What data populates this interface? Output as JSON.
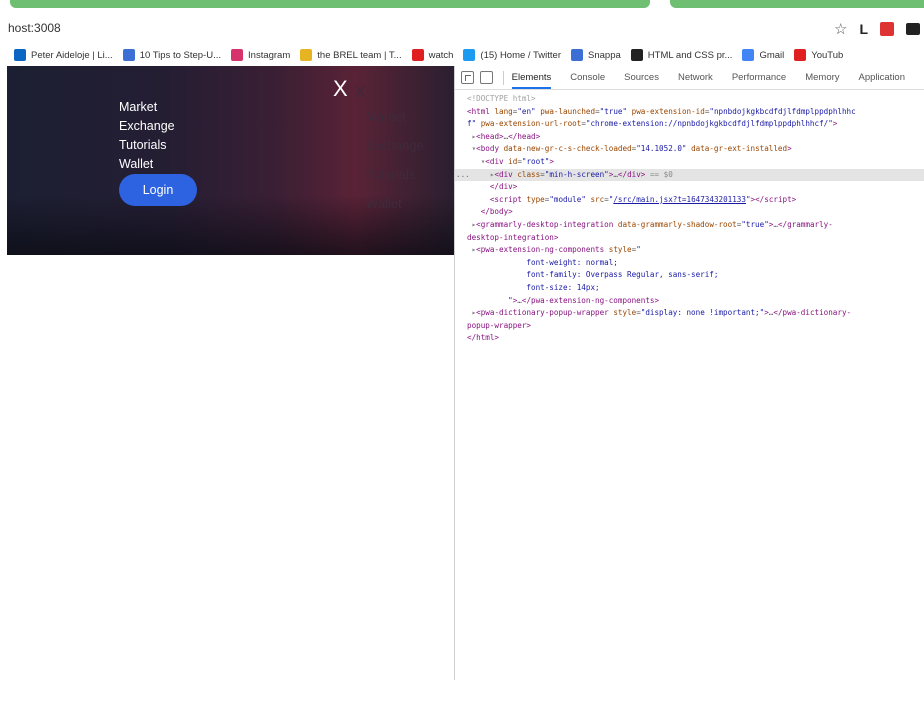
{
  "browser": {
    "url": "host:3008",
    "bookmarks": [
      {
        "label": "Peter Aideloje | Li...",
        "icon": "linkedin-icon",
        "color": "#0a66c2"
      },
      {
        "label": "10 Tips to Step-U...",
        "icon": "page-icon",
        "color": "#3b6fd6"
      },
      {
        "label": "Instagram",
        "icon": "instagram-icon",
        "color": "#d6336c"
      },
      {
        "label": "the BREL team | T...",
        "icon": "folder-icon",
        "color": "#e6b422"
      },
      {
        "label": "watch",
        "icon": "youtube-icon",
        "color": "#e02020"
      },
      {
        "label": "(15) Home / Twitter",
        "icon": "twitter-icon",
        "color": "#1d9bf0"
      },
      {
        "label": "Snappa",
        "icon": "page-icon",
        "color": "#3b6fd6"
      },
      {
        "label": "HTML and CSS pr...",
        "icon": "github-icon",
        "color": "#222222"
      },
      {
        "label": "Gmail",
        "icon": "google-icon",
        "color": "#4285f4"
      },
      {
        "label": "YouTub",
        "icon": "youtube-icon",
        "color": "#e02020"
      }
    ]
  },
  "page": {
    "menu": [
      "Market",
      "Exchange",
      "Tutorials",
      "Wallet"
    ],
    "login_label": "Login",
    "close_glyph": "X",
    "ghost_close_glyph": "X",
    "ghost_menu": [
      "Market",
      "Exchange",
      "Tutorials",
      "Wallet"
    ]
  },
  "devtools": {
    "tabs": [
      "Elements",
      "Console",
      "Sources",
      "Network",
      "Performance",
      "Memory",
      "Application"
    ],
    "active_tab": "Elements"
  }
}
